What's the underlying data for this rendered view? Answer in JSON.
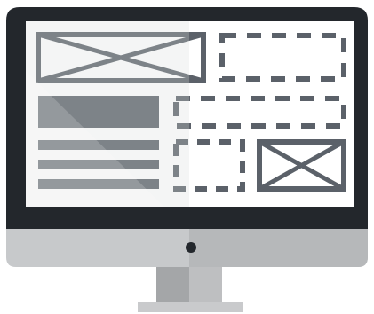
{
  "colors": {
    "bezel": "#23272c",
    "screen": "#ffffff",
    "wireframe": "#5b6169",
    "chin": "#c7c9cb",
    "chin_shade": "#b6b8ba",
    "stand": "#a4a6a8",
    "stand_shade": "#bebfc1",
    "base": "#c9cacc",
    "camera_dot": "#23272c",
    "glare": "#d9dadb"
  },
  "icons": {
    "monitor": "desktop-monitor-icon",
    "image_placeholder": "image-placeholder-icon"
  }
}
